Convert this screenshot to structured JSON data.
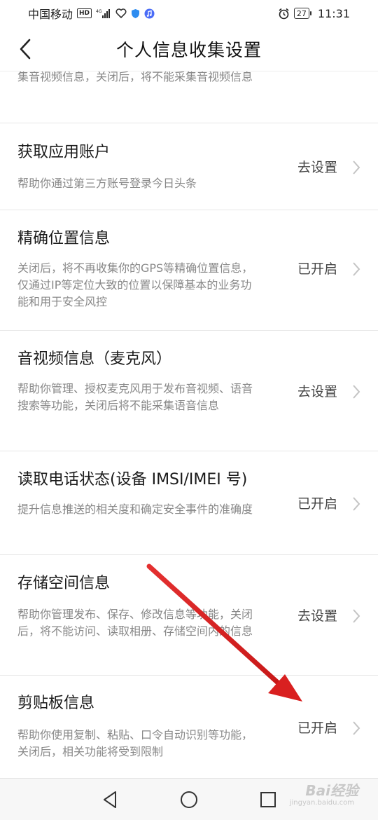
{
  "status_bar": {
    "carrier": "中国移动",
    "hd": "HD",
    "network": "4G",
    "battery": "27",
    "time": "11:31"
  },
  "header": {
    "title": "个人信息收集设置"
  },
  "partial_item": {
    "desc": "集音视频信息，关闭后，将不能采集音视频信息"
  },
  "items": [
    {
      "title": "获取应用账户",
      "desc": "帮助你通过第三方账号登录今日头条",
      "status": "去设置"
    },
    {
      "title": "精确位置信息",
      "desc": "关闭后，将不再收集你的GPS等精确位置信息，仅通过IP等定位大致的位置以保障基本的业务功能和用于安全风控",
      "status": "已开启"
    },
    {
      "title": "音视频信息（麦克风）",
      "desc": "帮助你管理、授权麦克风用于发布音视频、语音搜索等功能，关闭后将不能采集语音信息",
      "status": "去设置"
    },
    {
      "title": "读取电话状态(设备 IMSI/IMEI 号)",
      "desc": "提升信息推送的相关度和确定安全事件的准确度",
      "status": "已开启"
    },
    {
      "title": "存储空间信息",
      "desc": "帮助你管理发布、保存、修改信息等功能，关闭后，将不能访问、读取相册、存储空间内的信息",
      "status": "去设置"
    },
    {
      "title": "剪贴板信息",
      "desc": "帮助你使用复制、粘贴、口令自动识别等功能，关闭后，相关功能将受到限制",
      "status": "已开启"
    }
  ],
  "watermark": {
    "logo": "Bai经验",
    "sub": "jingyan.baidu.com"
  },
  "colors": {
    "annotation_arrow": "#e02020",
    "divider": "#e8e8e8",
    "desc_text": "#888888"
  },
  "icons": [
    "back-chevron-icon",
    "chevron-right-icon",
    "nav-back-triangle-icon",
    "nav-home-circle-icon",
    "nav-recents-square-icon",
    "alarm-icon",
    "signal-icon",
    "heart-icon",
    "shield-icon",
    "music-icon"
  ]
}
